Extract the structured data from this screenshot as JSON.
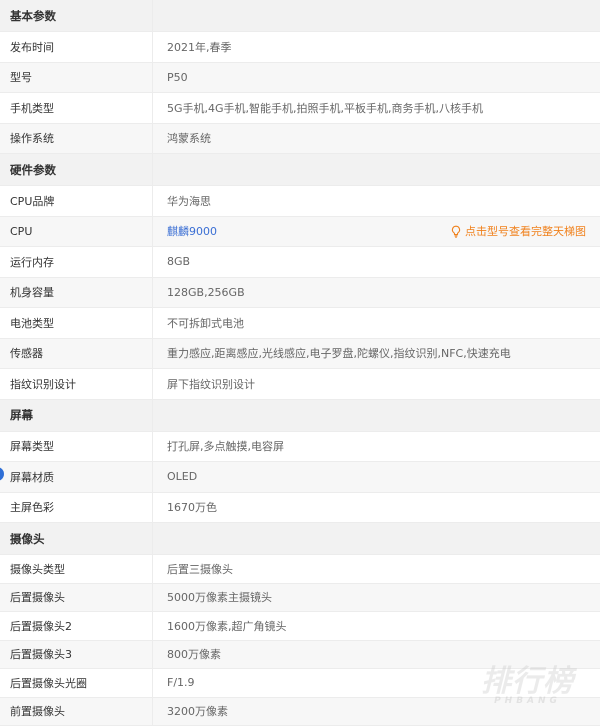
{
  "sections": [
    {
      "title": "基本参数",
      "rows": [
        {
          "k": "发布时间",
          "v": "2021年,春季"
        },
        {
          "k": "型号",
          "v": "P50"
        },
        {
          "k": "手机类型",
          "v": "5G手机,4G手机,智能手机,拍照手机,平板手机,商务手机,八核手机"
        },
        {
          "k": "操作系统",
          "v": "鸿蒙系统"
        }
      ]
    },
    {
      "title": "硬件参数",
      "rows": [
        {
          "k": "CPU品牌",
          "v": "华为海思"
        },
        {
          "k": "CPU",
          "v": "麒麟9000",
          "link": true,
          "tip": "点击型号查看完整天梯图"
        },
        {
          "k": "运行内存",
          "v": "8GB"
        },
        {
          "k": "机身容量",
          "v": "128GB,256GB"
        },
        {
          "k": "电池类型",
          "v": "不可拆卸式电池"
        },
        {
          "k": "传感器",
          "v": "重力感应,距离感应,光线感应,电子罗盘,陀螺仪,指纹识别,NFC,快速充电"
        },
        {
          "k": "指纹识别设计",
          "v": "屏下指纹识别设计"
        }
      ]
    },
    {
      "title": "屏幕",
      "rows": [
        {
          "k": "屏幕类型",
          "v": "打孔屏,多点触摸,电容屏"
        },
        {
          "k": "屏幕材质",
          "v": "OLED"
        },
        {
          "k": "主屏色彩",
          "v": "1670万色"
        }
      ]
    },
    {
      "title": "摄像头",
      "rows": [
        {
          "k": "摄像头类型",
          "v": "后置三摄像头"
        },
        {
          "k": "后置摄像头",
          "v": "5000万像素主摄镜头"
        },
        {
          "k": "后置摄像头2",
          "v": "1600万像素,超广角镜头"
        },
        {
          "k": "后置摄像头3",
          "v": "800万像素"
        },
        {
          "k": "后置摄像头光圈",
          "v": "F/1.9"
        },
        {
          "k": "前置摄像头",
          "v": "3200万像素"
        }
      ]
    }
  ],
  "watermark": {
    "big": "排行榜",
    "small": "PHBANG"
  },
  "colors": {
    "link": "#3b6fd4",
    "tip": "#f0811c",
    "section_bg": "#f2f2f2"
  }
}
